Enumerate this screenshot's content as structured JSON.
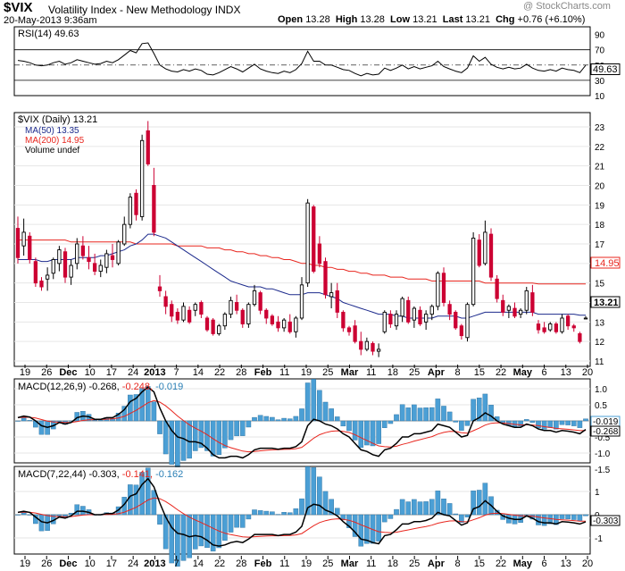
{
  "header": {
    "symbol": "$VIX",
    "name": "Volatility Index - New Methodology",
    "exchange": "INDX",
    "datetime": "20-May-2013 9:36am",
    "open_label": "Open",
    "open": "13.28",
    "high_label": "High",
    "high": "13.28",
    "low_label": "Low",
    "low": "13.21",
    "last_label": "Last",
    "last": "13.21",
    "chg_label": "Chg",
    "chg": "+0.76 (+6.10%)",
    "watermark": "@ StockCharts.com"
  },
  "colors": {
    "up": "#000000",
    "down": "#cc0033",
    "ma50": "#1c2a8c",
    "ma200": "#e8261e",
    "hist": "#4b9fd5",
    "macd": "#000000",
    "signal": "#e8261e",
    "hist_text": "#2a7fb5"
  },
  "rsi_panel": {
    "label": "RSI(14) 49.63",
    "current": "49.63",
    "ticks": [
      "90",
      "70",
      "50",
      "30",
      "10"
    ]
  },
  "price_panel": {
    "label_main": "$VIX (Daily) 13.21",
    "label_ma50": "MA(50) 13.35",
    "label_ma200": "MA(200) 14.95",
    "label_vol": "Volume undef",
    "ticks": [
      "23",
      "22",
      "21",
      "20",
      "19",
      "18",
      "17",
      "16",
      "15",
      "14",
      "13",
      "12",
      "11"
    ],
    "ma200_tag": "14.95",
    "last_tag": "13.21"
  },
  "macd1_panel": {
    "label_black": "MACD(12,26,9) -0.268,",
    "label_red": "-0.248,",
    "label_blue": "-0.019",
    "ticks": [
      "1.0",
      "0.5",
      "0.0",
      "-0.5",
      "-1.0",
      "-1.5"
    ],
    "tag_hist": "-0.019",
    "tag_macd": "-0.268"
  },
  "macd2_panel": {
    "label_black": "MACD(7,22,44) -0.303,",
    "label_red": "-0.141,",
    "label_blue": "-0.162",
    "ticks": [
      "1",
      "0",
      "-1"
    ],
    "tag_macd": "-0.303"
  },
  "x_axis": {
    "labels": [
      {
        "t": "19",
        "bold": false
      },
      {
        "t": "26",
        "bold": false
      },
      {
        "t": "Dec",
        "bold": true
      },
      {
        "t": "10",
        "bold": false
      },
      {
        "t": "17",
        "bold": false
      },
      {
        "t": "24",
        "bold": false
      },
      {
        "t": "2013",
        "bold": true
      },
      {
        "t": "7",
        "bold": false
      },
      {
        "t": "14",
        "bold": false
      },
      {
        "t": "22",
        "bold": false
      },
      {
        "t": "28",
        "bold": false
      },
      {
        "t": "Feb",
        "bold": true
      },
      {
        "t": "11",
        "bold": false
      },
      {
        "t": "19",
        "bold": false
      },
      {
        "t": "25",
        "bold": false
      },
      {
        "t": "Mar",
        "bold": true
      },
      {
        "t": "11",
        "bold": false
      },
      {
        "t": "18",
        "bold": false
      },
      {
        "t": "25",
        "bold": false
      },
      {
        "t": "Apr",
        "bold": true
      },
      {
        "t": "8",
        "bold": false
      },
      {
        "t": "15",
        "bold": false
      },
      {
        "t": "22",
        "bold": false
      },
      {
        "t": "May",
        "bold": true
      },
      {
        "t": "6",
        "bold": false
      },
      {
        "t": "13",
        "bold": false
      },
      {
        "t": "20",
        "bold": false
      }
    ]
  },
  "chart_data": {
    "type": "candlestick",
    "title": "$VIX Volatility Index - New Methodology INDX",
    "period": "Daily",
    "x_range": [
      "2012-11-16",
      "2013-05-20"
    ],
    "price_axis_range": [
      11,
      23
    ],
    "last": 13.21,
    "ohlc": [
      [
        17.8,
        18.4,
        16.0,
        16.3
      ],
      [
        16.9,
        18.3,
        16.4,
        17.6
      ],
      [
        17.4,
        17.6,
        16.0,
        16.2
      ],
      [
        16.1,
        16.3,
        14.8,
        15.0
      ],
      [
        15.1,
        15.3,
        14.6,
        14.8
      ],
      [
        15.2,
        15.8,
        14.6,
        15.4
      ],
      [
        15.5,
        16.3,
        15.2,
        16.2
      ],
      [
        16.0,
        16.9,
        15.6,
        16.7
      ],
      [
        16.6,
        16.8,
        15.0,
        15.3
      ],
      [
        15.3,
        16.2,
        14.9,
        15.9
      ],
      [
        16.0,
        17.3,
        15.7,
        17.0
      ],
      [
        16.9,
        17.4,
        16.2,
        16.4
      ],
      [
        16.3,
        16.9,
        15.7,
        16.1
      ],
      [
        16.0,
        16.5,
        15.4,
        15.6
      ],
      [
        15.6,
        16.2,
        15.3,
        15.9
      ],
      [
        15.8,
        16.7,
        15.5,
        16.5
      ],
      [
        16.4,
        17.0,
        15.8,
        16.2
      ],
      [
        16.0,
        17.2,
        15.9,
        17.1
      ],
      [
        17.0,
        18.4,
        16.9,
        18.0
      ],
      [
        18.0,
        19.6,
        17.8,
        19.4
      ],
      [
        19.6,
        19.8,
        18.2,
        18.5
      ],
      [
        18.4,
        22.6,
        18.2,
        22.3
      ],
      [
        22.8,
        23.3,
        21.0,
        21.1
      ],
      [
        20.0,
        20.9,
        17.4,
        17.6
      ],
      [
        14.8,
        15.4,
        14.3,
        14.6
      ],
      [
        14.3,
        14.6,
        13.4,
        13.8
      ],
      [
        13.9,
        14.1,
        13.0,
        13.3
      ],
      [
        13.5,
        13.7,
        12.9,
        13.1
      ],
      [
        13.1,
        14.0,
        13.0,
        13.8
      ],
      [
        13.6,
        13.8,
        12.9,
        13.0
      ],
      [
        13.6,
        14.0,
        13.3,
        13.9
      ],
      [
        14.0,
        14.1,
        13.2,
        13.4
      ],
      [
        13.2,
        13.3,
        12.5,
        12.6
      ],
      [
        13.1,
        13.2,
        12.3,
        12.4
      ],
      [
        12.4,
        12.9,
        12.3,
        12.8
      ],
      [
        12.8,
        13.5,
        12.6,
        13.4
      ],
      [
        13.4,
        14.3,
        13.2,
        14.1
      ],
      [
        14.0,
        14.4,
        13.4,
        13.6
      ],
      [
        13.6,
        13.7,
        12.7,
        12.9
      ],
      [
        12.9,
        14.0,
        12.7,
        13.9
      ],
      [
        13.9,
        14.9,
        13.8,
        14.6
      ],
      [
        14.5,
        14.6,
        13.4,
        13.6
      ],
      [
        13.6,
        13.7,
        12.9,
        13.2
      ],
      [
        13.3,
        13.4,
        12.8,
        12.9
      ],
      [
        13.0,
        13.3,
        12.5,
        12.7
      ],
      [
        12.7,
        13.2,
        12.5,
        13.1
      ],
      [
        13.0,
        13.4,
        12.4,
        12.5
      ],
      [
        12.5,
        13.3,
        12.2,
        13.2
      ],
      [
        13.2,
        15.3,
        13.1,
        14.9
      ],
      [
        15.0,
        19.3,
        14.8,
        19.1
      ],
      [
        18.9,
        19.0,
        15.5,
        15.6
      ],
      [
        17.0,
        17.4,
        15.8,
        16.0
      ],
      [
        16.1,
        16.3,
        14.2,
        14.4
      ],
      [
        14.3,
        15.0,
        13.7,
        14.5
      ],
      [
        14.6,
        15.0,
        13.2,
        13.5
      ],
      [
        13.5,
        13.6,
        12.5,
        12.7
      ],
      [
        12.7,
        12.8,
        12.3,
        12.5
      ],
      [
        12.8,
        13.1,
        11.9,
        12.0
      ],
      [
        12.0,
        12.5,
        11.3,
        11.6
      ],
      [
        11.6,
        12.2,
        11.5,
        12.0
      ],
      [
        11.9,
        12.0,
        11.3,
        11.5
      ],
      [
        11.5,
        11.9,
        11.2,
        11.6
      ],
      [
        12.5,
        13.6,
        12.4,
        13.5
      ],
      [
        13.4,
        13.6,
        12.7,
        12.9
      ],
      [
        12.8,
        13.6,
        12.6,
        13.4
      ],
      [
        13.3,
        14.3,
        13.0,
        14.2
      ],
      [
        14.1,
        14.3,
        12.9,
        13.0
      ],
      [
        13.1,
        13.8,
        12.7,
        13.7
      ],
      [
        13.6,
        13.8,
        12.8,
        12.9
      ],
      [
        13.0,
        13.6,
        12.6,
        13.4
      ],
      [
        13.4,
        13.9,
        13.1,
        13.8
      ],
      [
        13.8,
        15.6,
        13.6,
        15.5
      ],
      [
        15.5,
        15.8,
        13.8,
        14.0
      ],
      [
        13.9,
        14.1,
        13.1,
        13.4
      ],
      [
        13.5,
        13.6,
        12.6,
        12.7
      ],
      [
        12.8,
        12.9,
        12.1,
        12.3
      ],
      [
        12.2,
        14.0,
        12.0,
        13.9
      ],
      [
        13.9,
        17.6,
        13.8,
        17.3
      ],
      [
        17.2,
        17.5,
        15.8,
        15.9
      ],
      [
        16.0,
        18.2,
        15.9,
        17.6
      ],
      [
        17.5,
        17.8,
        15.1,
        15.3
      ],
      [
        15.2,
        15.4,
        14.0,
        14.2
      ],
      [
        14.1,
        14.4,
        13.3,
        13.5
      ],
      [
        13.6,
        13.9,
        13.2,
        13.8
      ],
      [
        13.7,
        14.0,
        13.2,
        13.3
      ],
      [
        13.4,
        13.7,
        13.2,
        13.6
      ],
      [
        13.6,
        14.8,
        13.4,
        14.6
      ],
      [
        14.5,
        14.9,
        13.3,
        13.5
      ],
      [
        12.9,
        13.1,
        12.4,
        12.6
      ],
      [
        12.7,
        13.0,
        12.4,
        12.5
      ],
      [
        12.6,
        13.0,
        12.5,
        12.9
      ],
      [
        12.9,
        13.0,
        12.4,
        12.5
      ],
      [
        12.5,
        13.4,
        12.4,
        13.2
      ],
      [
        13.3,
        13.4,
        12.6,
        12.8
      ],
      [
        12.8,
        12.9,
        12.5,
        12.7
      ],
      [
        12.4,
        12.5,
        11.9,
        12.0
      ],
      [
        13.2,
        13.3,
        13.2,
        13.2
      ]
    ],
    "series": [
      {
        "name": "MA(50)",
        "values": [
          16.2,
          16.2,
          16.2,
          16.2,
          16.1,
          16.1,
          16.2,
          16.2,
          16.2,
          16.2,
          16.3,
          16.3,
          16.3,
          16.3,
          16.4,
          16.4,
          16.5,
          16.6,
          16.7,
          16.9,
          17.0,
          17.2,
          17.5,
          17.5,
          17.4,
          17.3,
          17.1,
          16.9,
          16.7,
          16.5,
          16.3,
          16.1,
          15.9,
          15.7,
          15.5,
          15.3,
          15.1,
          15.0,
          14.9,
          14.8,
          14.8,
          14.8,
          14.7,
          14.7,
          14.6,
          14.5,
          14.4,
          14.4,
          14.4,
          14.5,
          14.5,
          14.5,
          14.4,
          14.3,
          14.2,
          14.0,
          13.9,
          13.8,
          13.7,
          13.6,
          13.5,
          13.4,
          13.4,
          13.4,
          13.3,
          13.3,
          13.2,
          13.2,
          13.2,
          13.2,
          13.2,
          13.3,
          13.3,
          13.3,
          13.3,
          13.2,
          13.2,
          13.3,
          13.4,
          13.5,
          13.5,
          13.5,
          13.5,
          13.5,
          13.5,
          13.5,
          13.5,
          13.5,
          13.4,
          13.4,
          13.4,
          13.4,
          13.4,
          13.4,
          13.4,
          13.35,
          13.35
        ]
      },
      {
        "name": "MA(200)",
        "values": [
          17.2,
          17.2,
          17.2,
          17.2,
          17.2,
          17.2,
          17.2,
          17.2,
          17.2,
          17.1,
          17.1,
          17.1,
          17.1,
          17.1,
          17.1,
          17.1,
          17.1,
          17.1,
          17.1,
          17.1,
          17.0,
          17.0,
          17.0,
          17.0,
          17.0,
          17.0,
          17.0,
          16.9,
          16.9,
          16.9,
          16.9,
          16.9,
          16.8,
          16.8,
          16.8,
          16.7,
          16.7,
          16.6,
          16.6,
          16.5,
          16.5,
          16.4,
          16.4,
          16.3,
          16.3,
          16.2,
          16.2,
          16.1,
          16.0,
          16.0,
          15.9,
          15.9,
          15.8,
          15.8,
          15.7,
          15.7,
          15.6,
          15.6,
          15.5,
          15.5,
          15.4,
          15.4,
          15.4,
          15.3,
          15.3,
          15.3,
          15.2,
          15.2,
          15.2,
          15.2,
          15.1,
          15.1,
          15.1,
          15.1,
          15.1,
          15.1,
          15.1,
          15.1,
          15.1,
          15.0,
          15.0,
          15.0,
          15.0,
          15.0,
          15.0,
          15.0,
          15.0,
          15.0,
          14.95,
          14.95,
          14.95,
          14.95,
          14.95,
          14.95,
          14.95,
          14.95,
          14.95
        ]
      },
      {
        "name": "RSI(14)",
        "values": [
          56,
          55,
          53,
          50,
          49,
          50,
          53,
          55,
          51,
          53,
          57,
          55,
          53,
          51,
          52,
          55,
          53,
          57,
          63,
          69,
          66,
          78,
          79,
          65,
          50,
          45,
          42,
          41,
          44,
          42,
          45,
          43,
          38,
          37,
          40,
          44,
          48,
          45,
          41,
          46,
          51,
          45,
          42,
          40,
          39,
          42,
          40,
          44,
          52,
          68,
          55,
          55,
          50,
          50,
          47,
          44,
          43,
          39,
          36,
          39,
          37,
          38,
          46,
          43,
          46,
          50,
          45,
          48,
          45,
          47,
          49,
          55,
          48,
          45,
          42,
          40,
          46,
          62,
          55,
          60,
          51,
          47,
          45,
          47,
          45,
          46,
          51,
          46,
          43,
          42,
          44,
          42,
          46,
          44,
          43,
          40,
          49.63
        ]
      },
      {
        "name": "MACD(12,26,9)",
        "values": [
          0.1,
          0.15,
          0.12,
          0.0,
          -0.15,
          -0.2,
          -0.15,
          -0.05,
          -0.1,
          -0.05,
          0.1,
          0.15,
          0.13,
          0.05,
          0.05,
          0.1,
          0.1,
          0.2,
          0.35,
          0.6,
          0.7,
          0.9,
          1.05,
          0.9,
          0.4,
          0.0,
          -0.3,
          -0.5,
          -0.55,
          -0.65,
          -0.65,
          -0.7,
          -0.85,
          -1.05,
          -1.15,
          -1.15,
          -1.1,
          -1.1,
          -1.15,
          -1.05,
          -0.9,
          -0.85,
          -0.85,
          -0.85,
          -0.88,
          -0.85,
          -0.85,
          -0.8,
          -0.65,
          -0.15,
          0.05,
          0.0,
          -0.1,
          -0.15,
          -0.25,
          -0.4,
          -0.5,
          -0.7,
          -0.9,
          -0.95,
          -1.05,
          -1.1,
          -0.9,
          -0.85,
          -0.7,
          -0.5,
          -0.5,
          -0.4,
          -0.4,
          -0.35,
          -0.3,
          -0.1,
          -0.15,
          -0.2,
          -0.35,
          -0.5,
          -0.45,
          0.0,
          0.1,
          0.25,
          0.15,
          0.0,
          -0.1,
          -0.15,
          -0.2,
          -0.2,
          -0.1,
          -0.15,
          -0.25,
          -0.3,
          -0.3,
          -0.35,
          -0.3,
          -0.32,
          -0.35,
          -0.4,
          -0.268
        ]
      },
      {
        "name": "MACD(7,22,44)",
        "values": [
          0.1,
          0.15,
          0.1,
          -0.1,
          -0.3,
          -0.35,
          -0.25,
          -0.1,
          -0.15,
          -0.05,
          0.15,
          0.15,
          0.1,
          0.0,
          0.0,
          0.05,
          0.05,
          0.2,
          0.45,
          0.8,
          0.9,
          1.3,
          1.55,
          1.2,
          0.5,
          -0.1,
          -0.55,
          -0.8,
          -0.85,
          -0.95,
          -0.9,
          -0.95,
          -1.1,
          -1.3,
          -1.35,
          -1.3,
          -1.2,
          -1.15,
          -1.2,
          -1.05,
          -0.85,
          -0.85,
          -0.85,
          -0.85,
          -0.9,
          -0.85,
          -0.85,
          -0.75,
          -0.5,
          0.3,
          0.45,
          0.4,
          0.2,
          0.1,
          -0.05,
          -0.3,
          -0.5,
          -0.75,
          -1.05,
          -1.1,
          -1.2,
          -1.25,
          -0.9,
          -0.85,
          -0.65,
          -0.4,
          -0.4,
          -0.3,
          -0.3,
          -0.25,
          -0.15,
          0.1,
          0.0,
          -0.05,
          -0.25,
          -0.45,
          -0.35,
          0.25,
          0.35,
          0.6,
          0.4,
          0.15,
          -0.05,
          -0.15,
          -0.2,
          -0.2,
          -0.05,
          -0.15,
          -0.3,
          -0.35,
          -0.35,
          -0.4,
          -0.3,
          -0.32,
          -0.35,
          -0.4,
          -0.303
        ]
      }
    ]
  }
}
